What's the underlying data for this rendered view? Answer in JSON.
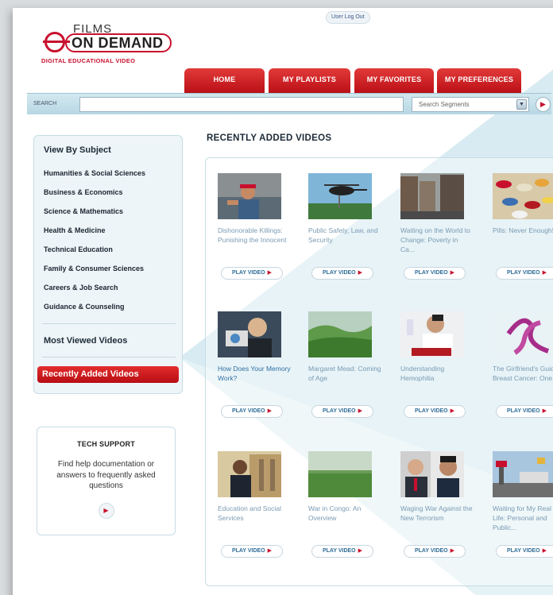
{
  "header": {
    "logo_top": "FILMS",
    "logo_main": "ON DEMAND",
    "logo_tagline": "DIGITAL EDUCATIONAL VIDEO",
    "user_link": "User Log Out"
  },
  "nav": {
    "tabs": [
      {
        "label": "HOME"
      },
      {
        "label": "MY PLAYLISTS"
      },
      {
        "label": "MY FAVORITES"
      },
      {
        "label": "MY PREFERENCES"
      }
    ]
  },
  "search": {
    "label": "SEARCH",
    "value": "",
    "scope": "Search Segments"
  },
  "sidebar": {
    "title": "View By Subject",
    "subjects": [
      "Humanities & Social Sciences",
      "Business & Economics",
      "Science & Mathematics",
      "Health & Medicine",
      "Technical Education",
      "Family & Consumer Sciences",
      "Careers & Job Search",
      "Guidance & Counseling"
    ],
    "most_viewed": "Most Viewed Videos",
    "recently_added": "Recently Added Videos"
  },
  "tech_support": {
    "title": "TECH SUPPORT",
    "description": "Find help documentation or answers to frequently asked questions"
  },
  "main": {
    "title": "RECENTLY ADDED VIDEOS",
    "play_label": "PLAY VIDEO",
    "videos": [
      {
        "title": "Dishonorable Killings: Punishing the Innocent",
        "thumb": "man-in-hat"
      },
      {
        "title": "Public Safety, Law, and Security",
        "thumb": "helicopter"
      },
      {
        "title": "Waiting on the World to Change: Poverty in Ca...",
        "thumb": "street"
      },
      {
        "title": "Pills: Never Enough!",
        "thumb": "pills"
      },
      {
        "title": "How Does Your Memory Work?",
        "thumb": "camera-man"
      },
      {
        "title": "Margaret Mead: Coming of Age",
        "thumb": "green-hills"
      },
      {
        "title": "Understanding Hemophilia",
        "thumb": "lab-scientist"
      },
      {
        "title": "The Girlfriend's Guide to Breast Cancer: One...",
        "thumb": "pink-ribbon"
      },
      {
        "title": "Education and Social Services",
        "thumb": "woman-campus"
      },
      {
        "title": "War in Congo: An Overview",
        "thumb": "grass-field"
      },
      {
        "title": "Waging War Against the New Terrorism",
        "thumb": "two-men"
      },
      {
        "title": "Waiting for My Real Life: Personal and Public...",
        "thumb": "gas-station"
      }
    ]
  },
  "colors": {
    "brand_red": "#c8102e",
    "link_blue": "#3170a3",
    "panel_bg": "#eef5f8"
  }
}
